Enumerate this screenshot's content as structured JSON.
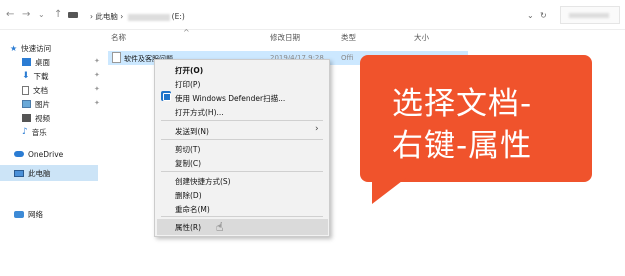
{
  "addressbar": {
    "back_icon": "←",
    "forward_icon": "→",
    "recent_icon": "⌄",
    "up_icon": "↑",
    "path_root": "此电脑",
    "path_sep": "›",
    "drive_suffix": "(E:)",
    "dropdown_icon": "⌄",
    "refresh_icon": "↻"
  },
  "sidebar": {
    "items": [
      {
        "label": "快速访问"
      },
      {
        "label": "桌面"
      },
      {
        "label": "下载"
      },
      {
        "label": "文档"
      },
      {
        "label": "图片"
      },
      {
        "label": "视频"
      },
      {
        "label": "音乐"
      },
      {
        "label": "OneDrive"
      },
      {
        "label": "此电脑"
      },
      {
        "label": "网络"
      }
    ],
    "pin_icon": "✦"
  },
  "columns": {
    "name": "名称",
    "date": "修改日期",
    "type": "类型",
    "size": "大小",
    "sort_caret": "^"
  },
  "file": {
    "name": "软件及客服问题",
    "date": "2019/4/17 9:28",
    "type": "Offi"
  },
  "context_menu": {
    "open": "打开(O)",
    "print": "打印(P)",
    "defender": "使用 Windows Defender扫描...",
    "open_with": "打开方式(H)...",
    "send_to": "发送到(N)",
    "cut": "剪切(T)",
    "copy": "复制(C)",
    "shortcut": "创建快捷方式(S)",
    "delete": "删除(D)",
    "rename": "重命名(M)",
    "properties": "属性(R)",
    "submenu_arrow": "›",
    "cursor_icon": "☝"
  },
  "callout": {
    "line1": "选择文档-",
    "line2": "右键-属性",
    "color": "#f0532c"
  }
}
